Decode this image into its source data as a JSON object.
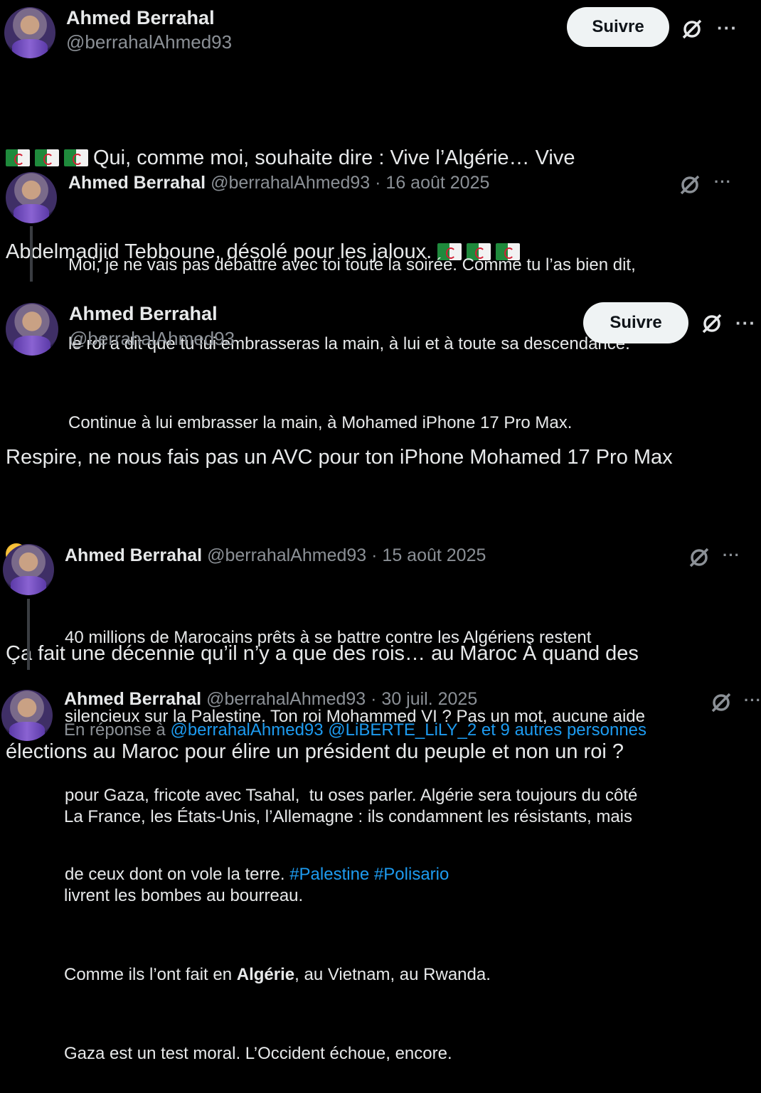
{
  "post1": {
    "name": "Ahmed Berrahal",
    "handle": "@berrahalAhmed93",
    "follow_label": "Suivre",
    "text": "Qui, comme moi, souhaite dire : Vive l’Algérie… Vive",
    "text2": "Abdelmadjid Tebboune, désolé pour les jaloux."
  },
  "quote1": {
    "name": "Ahmed Berrahal",
    "meta": "@berrahalAhmed93 · 16 août 2025",
    "lines": [
      "Moi, je ne vais pas débattre avec toi toute la soirée. Comme tu l’as bien dit,",
      "le roi a dit que tu lui embrasseras la main, à lui et à toute sa descendance.",
      "Continue à lui embrasser la main, à Mohamed iPhone 17 Pro Max."
    ]
  },
  "post2": {
    "name": "Ahmed Berrahal",
    "handle": "@berrahalAhmed93",
    "follow_label": "Suivre",
    "line1": "Respire, ne nous fais pas un AVC pour ton iPhone Mohamed 17 Pro Max",
    "line2": ".",
    "line3": "Ça fait une décennie qu’il n’y a que des rois… au Maroc À quand des",
    "line4": "élections au Maroc pour élire un président du peuple et non un roi ?"
  },
  "quote2": {
    "name": "Ahmed Berrahal",
    "meta": "@berrahalAhmed93 · 15 août 2025",
    "lines": [
      "40 millions de Marocains prêts à se battre contre les Algériens restent",
      "silencieux sur la Palestine. Ton roi Mohammed VI ? Pas un mot, aucune aide",
      "pour Gaza, fricote avec Tsahal,  tu oses parler. Algérie sera toujours du côté"
    ],
    "line4": "de ceux dont on vole la terre.",
    "hashtags": "#Palestine #Polisario"
  },
  "quote3": {
    "name": "Ahmed Berrahal",
    "meta": "@berrahalAhmed93 · 30 juil. 2025",
    "reply_prefix": "En réponse à",
    "reply_targets": "@berrahalAhmed93 @LiBERTE_LiLY_2  et 9 autres personnes",
    "line1": "La France, les États-Unis, l’Allemagne : ils condamnent les résistants, mais",
    "line2": "livrent les bombes au bourreau.",
    "line3_pre": "Comme ils l’ont fait en ",
    "line3_bold": "Algérie",
    "line3_post": ", au Vietnam, au Rwanda.",
    "line4": "Gaza est un test moral. L’Occident échoue, encore."
  },
  "icons": {
    "more": "···",
    "grok": "grok-icon",
    "flag": "algeria-flag-icon",
    "emoji": "sweat-smile-emoji"
  },
  "colors": {
    "link": "#1d9bf0",
    "muted": "#8b9096",
    "text": "#e7e9ea"
  }
}
